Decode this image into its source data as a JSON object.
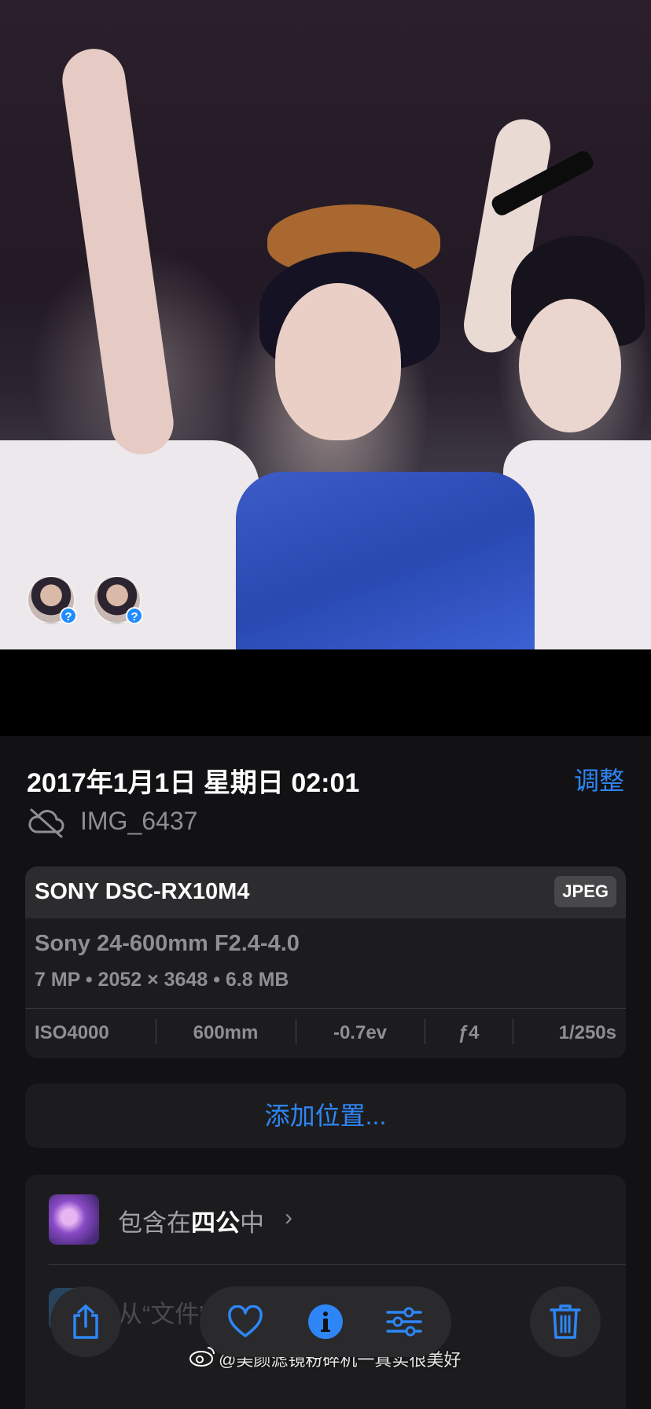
{
  "photo": {
    "face_tags": [
      {
        "badge": "?"
      },
      {
        "badge": "?"
      }
    ]
  },
  "info": {
    "datetime": "2017年1月1日 星期日 02:01",
    "adjust_label": "调整",
    "filename": "IMG_6437",
    "cloud_status_icon": "cloud-slash-icon"
  },
  "exif": {
    "camera": "SONY DSC-RX10M4",
    "format": "JPEG",
    "lens": "Sony 24-600mm F2.4-4.0",
    "specs": "7 MP • 2052 × 3648 • 6.8 MB",
    "iso": "ISO4000",
    "focal_length": "600mm",
    "exposure_comp": "-0.7ev",
    "aperture": "ƒ4",
    "shutter": "1/250s"
  },
  "location": {
    "add_label": "添加位置..."
  },
  "album": {
    "prefix": "包含在",
    "name": "四公",
    "suffix": "中",
    "chevron": "›",
    "files_text": "从“文件”"
  },
  "toolbar": {
    "share_icon": "share-icon",
    "favorite_icon": "heart-icon",
    "info_icon": "info-icon",
    "adjust_icon": "sliders-icon",
    "delete_icon": "trash-icon"
  },
  "watermark": {
    "text": "@美颜滤镜粉碎机一真实很美好"
  },
  "colors": {
    "accent": "#2e86f6",
    "background": "#121214",
    "card": "#1c1c1e"
  }
}
